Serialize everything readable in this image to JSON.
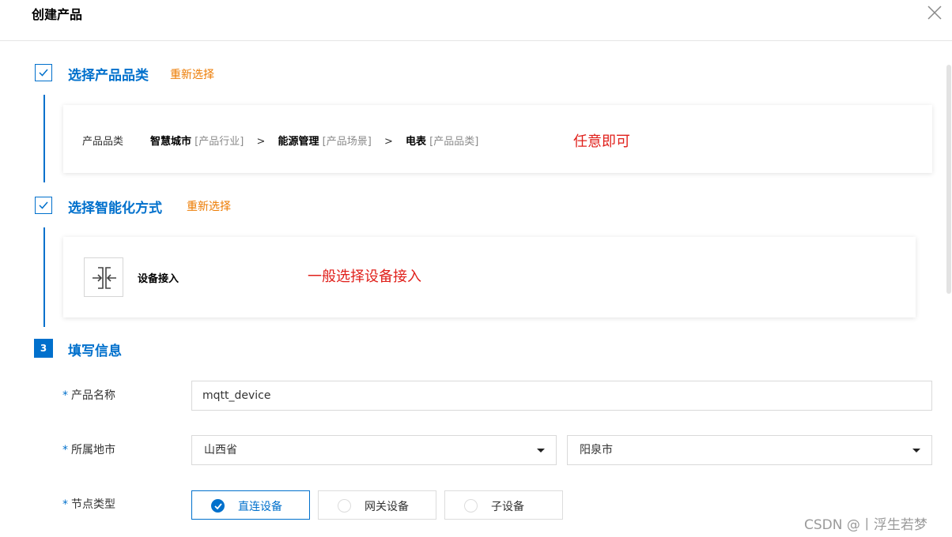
{
  "dialog": {
    "title": "创建产品"
  },
  "step1": {
    "title": "选择产品品类",
    "reselect": "重新选择",
    "category_label": "产品品类",
    "path": [
      {
        "name": "智慧城市",
        "tag": "[产品行业]"
      },
      {
        "name": "能源管理",
        "tag": "[产品场景]"
      },
      {
        "name": "电表",
        "tag": "[产品品类]"
      }
    ],
    "separator": ">",
    "annotation": "任意即可"
  },
  "step2": {
    "title": "选择智能化方式",
    "reselect": "重新选择",
    "method_label": "设备接入",
    "method_icon": "device-access-icon",
    "annotation": "一般选择设备接入"
  },
  "step3": {
    "number": "3",
    "title": "填写信息",
    "required_mark": "*",
    "fields": {
      "product_name": {
        "label": "产品名称",
        "value": "mqtt_device"
      },
      "city": {
        "label": "所属地市",
        "province": "山西省",
        "city": "阳泉市"
      },
      "node_type": {
        "label": "节点类型",
        "options": [
          "直连设备",
          "网关设备",
          "子设备"
        ],
        "selected": "直连设备"
      }
    }
  },
  "watermark": "CSDN @丨浮生若梦",
  "colors": {
    "primary": "#0070cc",
    "accent": "#ec7a00",
    "annotation": "#e0201b"
  }
}
